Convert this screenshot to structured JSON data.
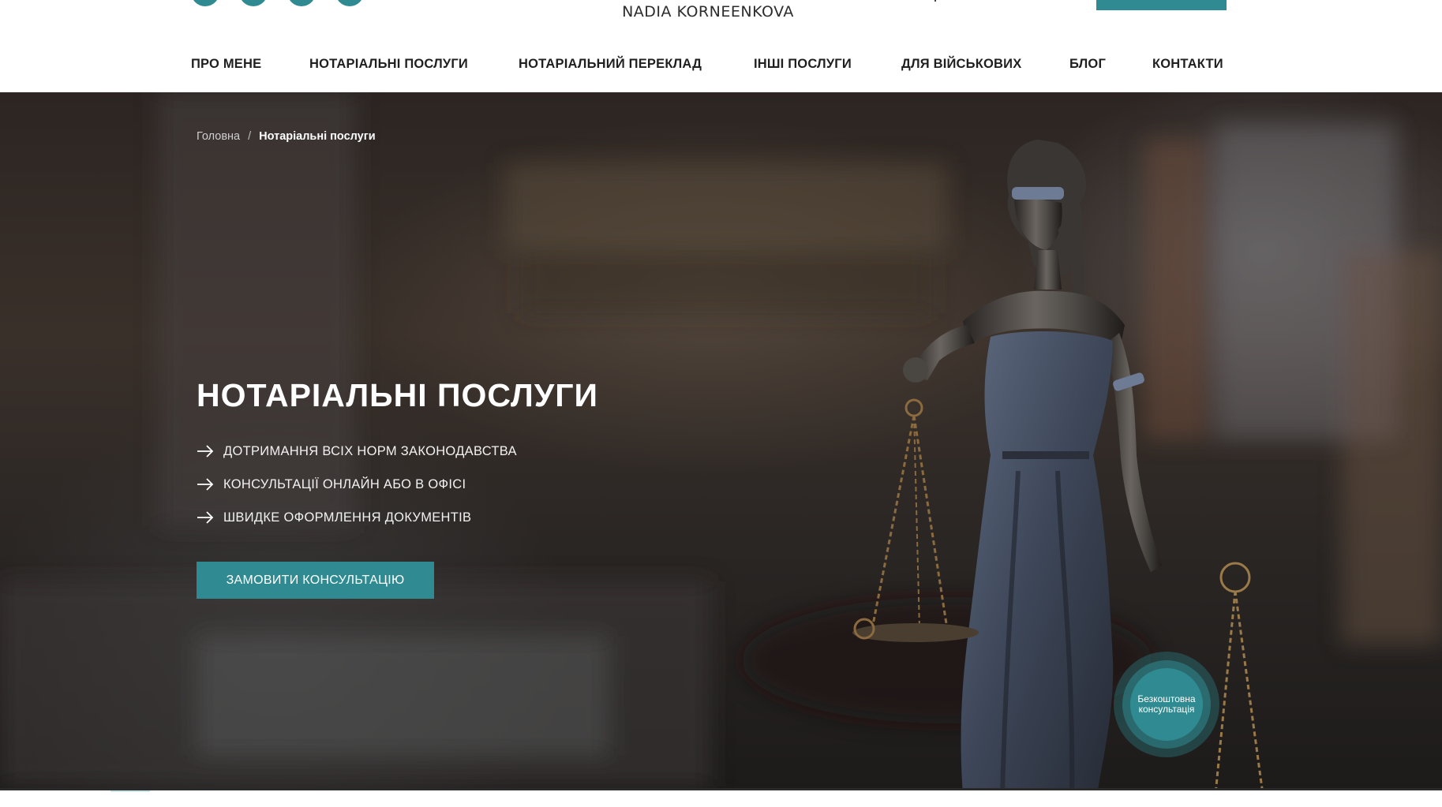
{
  "header": {
    "logo": "NADIA KORNEENKOVA",
    "social_icons": [
      "social-icon",
      "social-icon",
      "social-icon",
      "social-icon"
    ]
  },
  "nav": {
    "items": [
      {
        "label": "ПРО МЕНЕ"
      },
      {
        "label": "НОТАРІАЛЬНІ ПОСЛУГИ"
      },
      {
        "label": "НОТАРІАЛЬНИЙ ПЕРЕКЛАД"
      },
      {
        "label": "ІНШІ ПОСЛУГИ"
      },
      {
        "label": "ДЛЯ ВІЙСЬКОВИХ"
      },
      {
        "label": "БЛОГ"
      },
      {
        "label": "КОНТАКТИ"
      }
    ]
  },
  "breadcrumb": {
    "home": "Головна",
    "separator": "/",
    "current": "Нотаріальні послуги"
  },
  "hero": {
    "title": "НОТАРІАЛЬНІ ПОСЛУГИ",
    "features": [
      "ДОТРИМАННЯ ВСІХ НОРМ ЗАКОНОДАВСТВА",
      "КОНСУЛЬТАЦІЇ ОНЛАЙН АБО В ОФІСІ",
      "ШВИДКЕ ОФОРМЛЕННЯ ДОКУМЕНТІВ"
    ],
    "cta_label": "ЗАМОВИТИ КОНСУЛЬТАЦІЮ"
  },
  "badge": {
    "line1": "Безкоштовна",
    "line2": "консультація"
  },
  "colors": {
    "accent": "#2f8b91",
    "hero_dark": "#2c2522",
    "text_dark": "#1f1f1f"
  }
}
